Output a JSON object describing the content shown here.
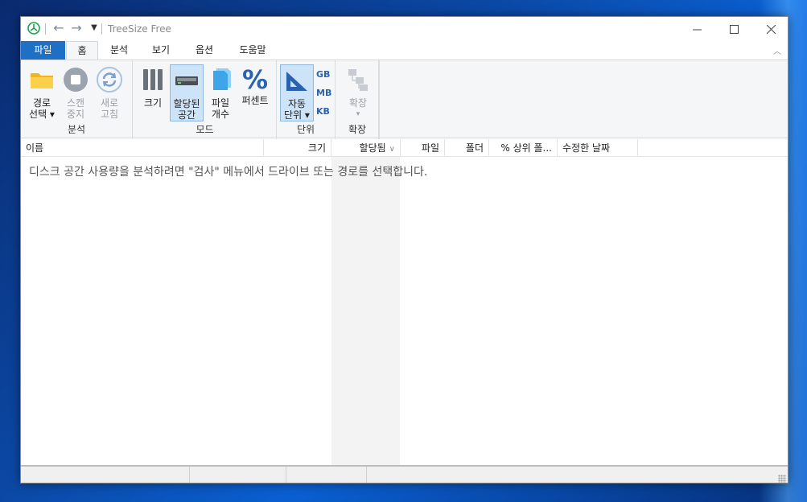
{
  "window": {
    "title": "TreeSize Free",
    "icon": "treesize-logo-icon"
  },
  "quick_access": {
    "back_icon": "arrow-left-icon",
    "forward_icon": "arrow-right-icon",
    "customize_icon": "dropdown-caret-icon"
  },
  "tabs": [
    {
      "label": "파일",
      "type": "file"
    },
    {
      "label": "홈",
      "type": "active"
    },
    {
      "label": "분석",
      "type": "normal"
    },
    {
      "label": "보기",
      "type": "normal"
    },
    {
      "label": "옵션",
      "type": "normal"
    },
    {
      "label": "도움말",
      "type": "normal"
    }
  ],
  "ribbon": {
    "groups": {
      "analysis": {
        "label": "분석",
        "select_path": "경로\n선택 ▾",
        "stop_scan": "스캔\n중지",
        "refresh": "새로\n고침"
      },
      "mode": {
        "label": "모드",
        "size": "크기",
        "allocated": "할당된\n공간",
        "file_count": "파일\n개수",
        "percent": "퍼센트"
      },
      "unit": {
        "label": "단위",
        "auto_unit": "자동\n단위 ▾",
        "gb": "GB",
        "mb": "MB",
        "kb": "KB"
      },
      "expand": {
        "label": "확장",
        "expand": "확장",
        "expand_caret": "▾"
      }
    }
  },
  "columns": [
    {
      "label": "이름"
    },
    {
      "label": "크기"
    },
    {
      "label": "할당됨"
    },
    {
      "label": "파일"
    },
    {
      "label": "폴더"
    },
    {
      "label": "% 상위 폴..."
    },
    {
      "label": "수정한 날짜"
    }
  ],
  "sort_indicator": "∨",
  "empty_message": "디스크 공간 사용량을 분석하려면 \"검사\" 메뉴에서 드라이브 또는 경로를 선택합니다.",
  "colors": {
    "accent": "#1f6fc4",
    "selected": "#cde3f7",
    "unit_text": "#2a62b0"
  }
}
